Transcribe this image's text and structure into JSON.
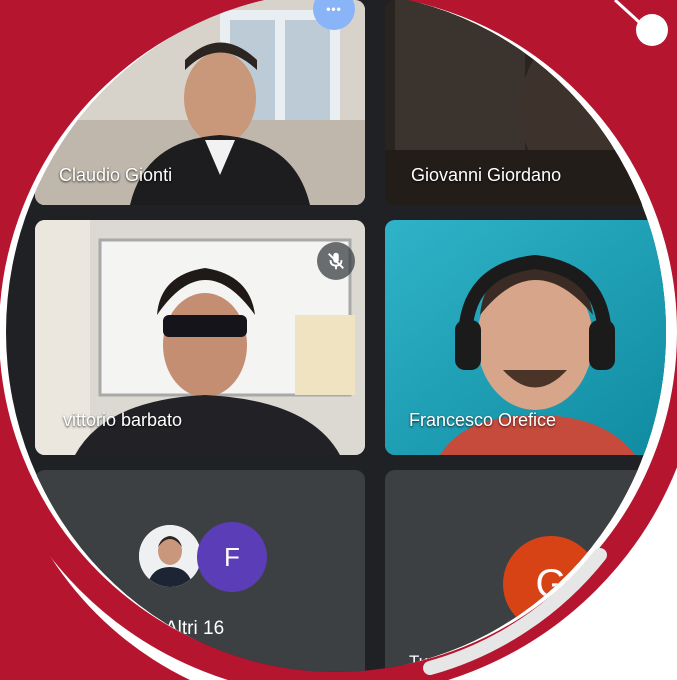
{
  "colors": {
    "frame_red": "#b5152f",
    "meet_bg": "#202124",
    "tile_bg": "#3c4043",
    "active_border": "#8ab4f8",
    "avatar_f": "#5c3db8",
    "avatar_g": "#d84315"
  },
  "participants": [
    {
      "name": "Claudio Gionti",
      "active": true,
      "video": true
    },
    {
      "name": "Giovanni Giordano",
      "video": true
    },
    {
      "name": "vittorio barbato",
      "video": true,
      "muted": true
    },
    {
      "name": "Francesco Orefice",
      "video": true
    }
  ],
  "others_tile": {
    "avatar_letter": "F",
    "label": "Altri 16"
  },
  "self_tile": {
    "avatar_letter": "G",
    "label": "Tu"
  },
  "icons": {
    "more": "more-options-icon",
    "mic": "mic-off-icon"
  },
  "more_glyph": "•••"
}
